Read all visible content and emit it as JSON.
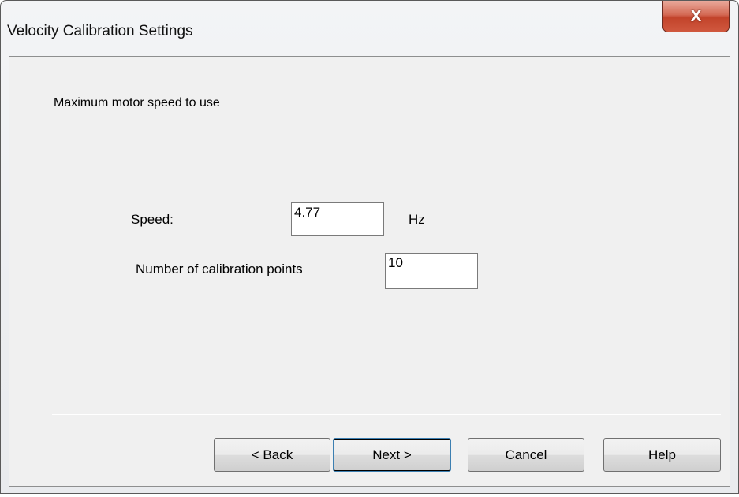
{
  "window": {
    "title": "Velocity Calibration Settings",
    "close_symbol": "X"
  },
  "content": {
    "heading": "Maximum motor speed to use",
    "speed": {
      "label": "Speed:",
      "value": "4.77",
      "unit": "Hz"
    },
    "points": {
      "label": "Number of calibration points",
      "value": "10"
    }
  },
  "buttons": {
    "back": "< Back",
    "next": "Next >",
    "cancel": "Cancel",
    "help": "Help"
  },
  "icons": {
    "close": "close-icon"
  },
  "colors": {
    "close_button": "#c7452e",
    "dialog_background": "#f0f0f0",
    "default_button_border": "#3c7fb1"
  }
}
